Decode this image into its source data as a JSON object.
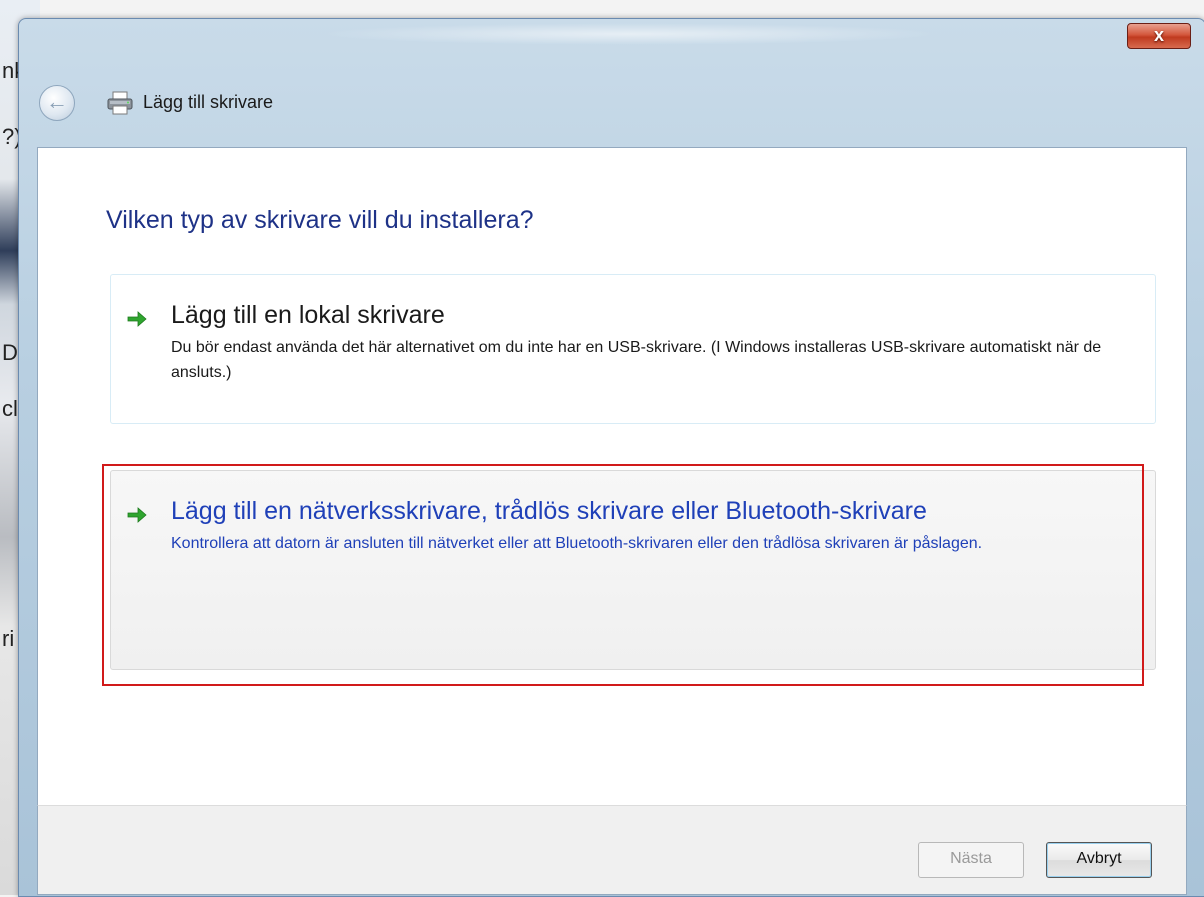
{
  "window": {
    "title": "Lägg till skrivare",
    "close_label": "x",
    "back_icon": "back-arrow-icon",
    "title_icon": "printer-icon"
  },
  "desktop": {
    "fragments": [
      "nk",
      "?)",
      "D)",
      "cl",
      "ri"
    ]
  },
  "main": {
    "heading": "Vilken typ av skrivare vill du installera?",
    "options": [
      {
        "icon": "green-arrow-icon",
        "title": "Lägg till en lokal skrivare",
        "description": "Du bör endast använda det här alternativet om du inte har en USB-skrivare. (I Windows installeras USB-skrivare automatiskt när de ansluts.)"
      },
      {
        "icon": "green-arrow-icon",
        "title": "Lägg till en nätverksskrivare, trådlös skrivare eller Bluetooth-skrivare",
        "description": "Kontrollera att datorn är ansluten till nätverket eller att Bluetooth-skrivaren eller den trådlösa skrivaren är påslagen.",
        "highlight_color": "#d11a1a"
      }
    ]
  },
  "footer": {
    "next_label": "Nästa",
    "cancel_label": "Avbryt"
  },
  "colors": {
    "heading": "#1e3287",
    "link": "#1f40b8",
    "arrow": "#2fa52f",
    "close": "#c03a1f"
  }
}
